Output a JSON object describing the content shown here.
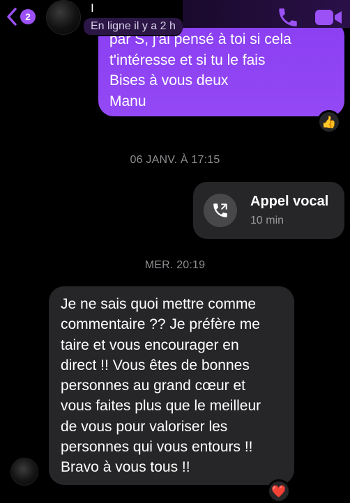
{
  "header": {
    "unread_count": "2",
    "contact_name": "I",
    "status": "En ligne il y a 2 h",
    "back_icon": "chevron-left-icon",
    "call_icon": "phone-icon",
    "video_icon": "video-camera-icon"
  },
  "messages": {
    "outgoing_1": {
      "lines": [
        "par S, j'ai pensé à toi si cela",
        "t'intéresse et si tu le fais",
        "Bises à vous deux",
        "Manu"
      ],
      "reaction": "👍"
    },
    "timestamp_1": "06 JANV. À 17:15",
    "call": {
      "title": "Appel vocal",
      "duration": "10 min",
      "icon": "phone-outgoing-icon"
    },
    "timestamp_2": "MER. 20:19",
    "incoming_1": {
      "lines": [
        "Je ne sais quoi mettre comme",
        "commentaire ?? Je préfère me",
        "taire et vous encourager en",
        "direct !! Vous êtes de bonnes",
        "personnes au grand cœur et",
        "vous faites plus que le meilleur",
        "de vous pour valoriser les",
        "personnes qui vous entours !!",
        "Bravo à vous tous !!"
      ],
      "reaction": "❤️"
    }
  },
  "colors": {
    "background": "#000000",
    "outgoing_bubble": "#8a3ff2",
    "incoming_bubble": "#262628",
    "accent": "#9b51f5",
    "timestamp": "#8e8e93"
  }
}
